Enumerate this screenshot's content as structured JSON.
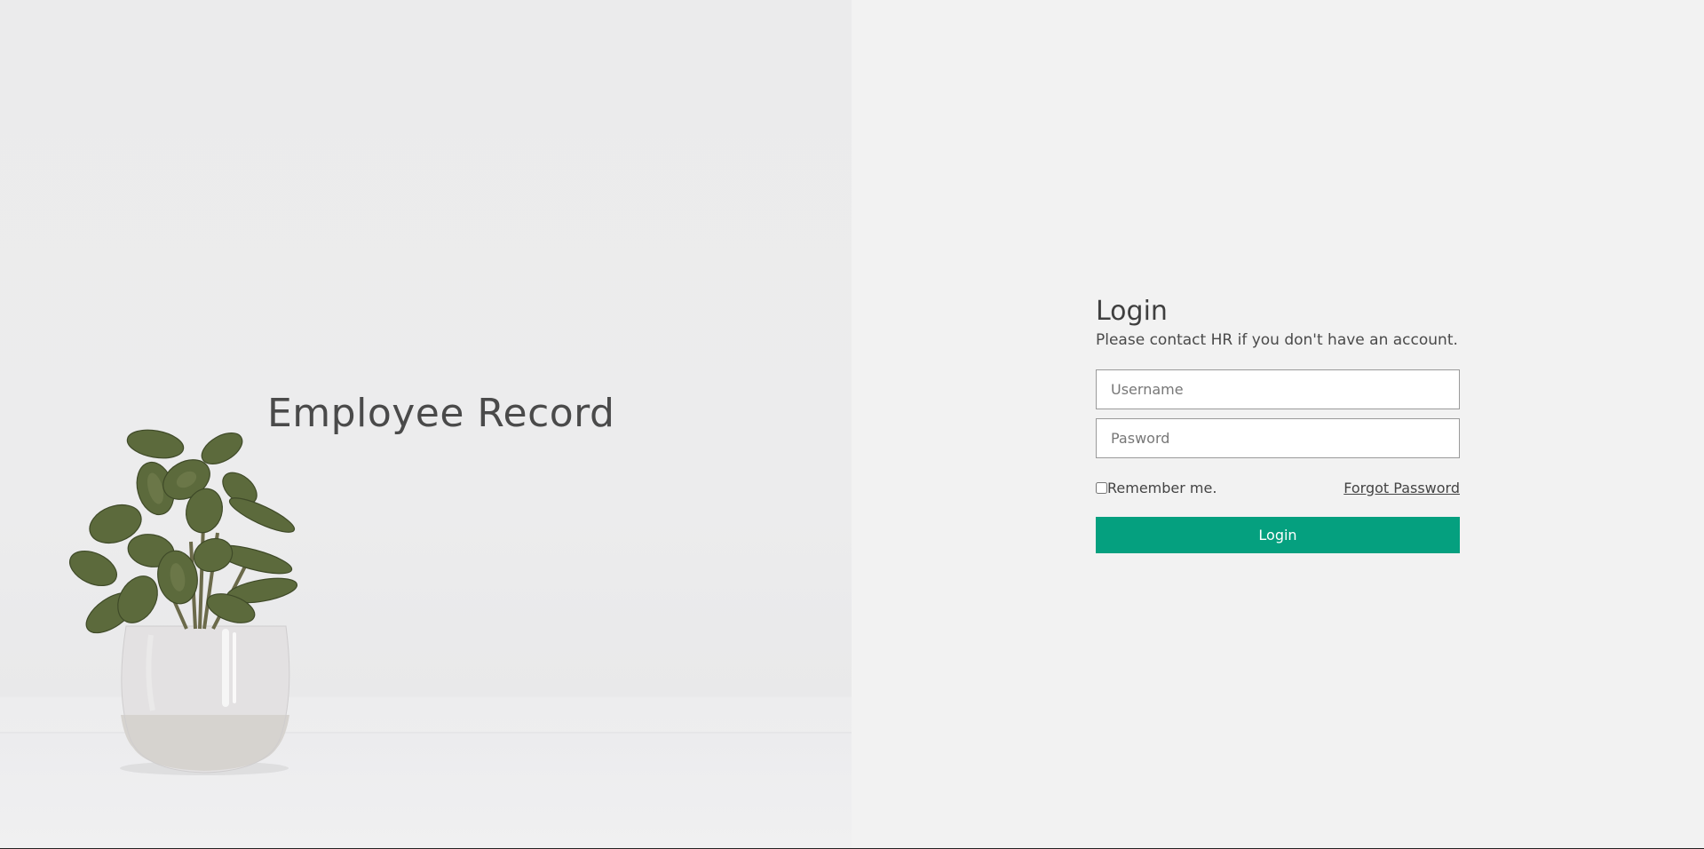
{
  "hero": {
    "title": "Employee Record"
  },
  "login": {
    "title": "Login",
    "subtitle": "Please contact HR if you don't have an account.",
    "username_placeholder": "Username",
    "password_placeholder": "Pasword",
    "remember_label": "Remember me.",
    "remember_checked": false,
    "forgot_label": "Forgot Password",
    "submit_label": "Login"
  },
  "colors": {
    "accent": "#05a07f",
    "page_bg": "#f2f2f2",
    "hero_bg": "#ebebec",
    "text": "#444444"
  }
}
